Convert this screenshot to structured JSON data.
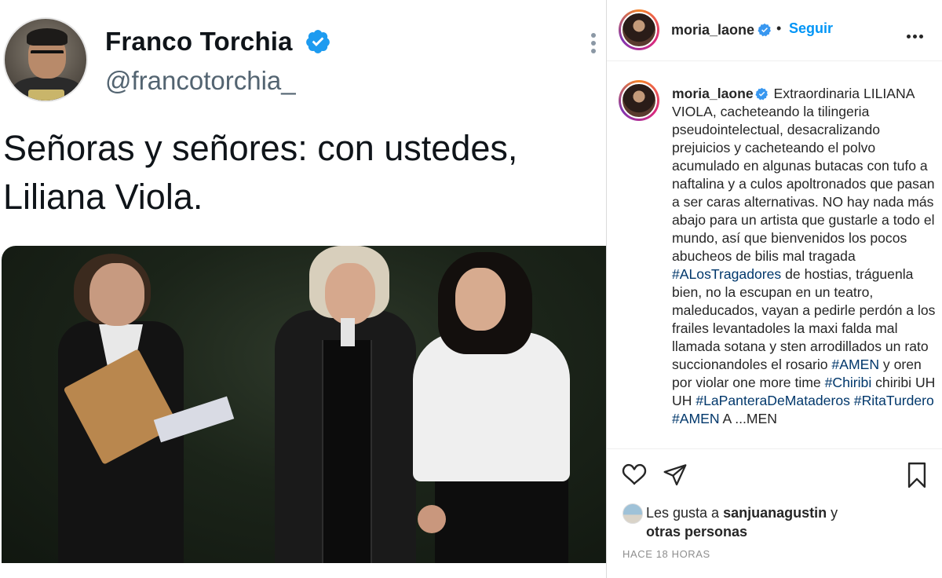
{
  "tweet": {
    "name": "Franco Torchia",
    "handle": "@francotorchia_",
    "text_line1": "Señoras y señores: con ustedes,",
    "text_line2": "Liliana Viola."
  },
  "instagram": {
    "username": "moria_laone",
    "separator": "•",
    "follow_label": "Seguir",
    "caption": {
      "username": "moria_laone",
      "segments": [
        {
          "text": "Extraordinaria LILIANA VIOLA, cacheteando la tilingeria pseudointelectual, desacralizando prejuicios y cacheteando el polvo acumulado en algunas butacas con tufo a naftalina y a culos apoltronados que pasan a ser caras alternativas. NO hay nada más abajo para un artista que gustarle a todo el mundo, así que bienvenidos los pocos abucheos de bilis mal tragada ",
          "tag": false
        },
        {
          "text": "#ALosTragadores",
          "tag": true
        },
        {
          "text": " de hostias, tráguenla bien, no la escupan en un teatro, maleducados, vayan a pedirle perdón a los frailes levantadoles la maxi falda mal llamada sotana y sten arrodillados un rato succionandoles el rosario ",
          "tag": false
        },
        {
          "text": "#AMEN",
          "tag": true
        },
        {
          "text": " y oren por violar one more time ",
          "tag": false
        },
        {
          "text": "#Chiribi",
          "tag": true
        },
        {
          "text": " chiribi UH UH ",
          "tag": false
        },
        {
          "text": "#LaPanteraDeMataderos",
          "tag": true
        },
        {
          "text": " ",
          "tag": false
        },
        {
          "text": "#RitaTurdero",
          "tag": true
        },
        {
          "text": " ",
          "tag": false
        },
        {
          "text": "#AMEN",
          "tag": true
        },
        {
          "text": " A ...MEN",
          "tag": false
        }
      ]
    },
    "likes": {
      "prefix": "Les gusta a ",
      "user": "sanjuanagustin",
      "middle": " y",
      "others": "otras personas"
    },
    "timestamp": "HACE 18 HORAS",
    "icons": {
      "like": "heart-icon",
      "share": "paper-plane-icon",
      "save": "bookmark-icon",
      "options": "ellipsis-icon",
      "verified": "verified-badge-icon"
    },
    "colors": {
      "link_blue": "#0095f6",
      "hashtag": "#00376b",
      "verified": "#3897f0",
      "twitter_verified": "#1d9bf0"
    }
  }
}
